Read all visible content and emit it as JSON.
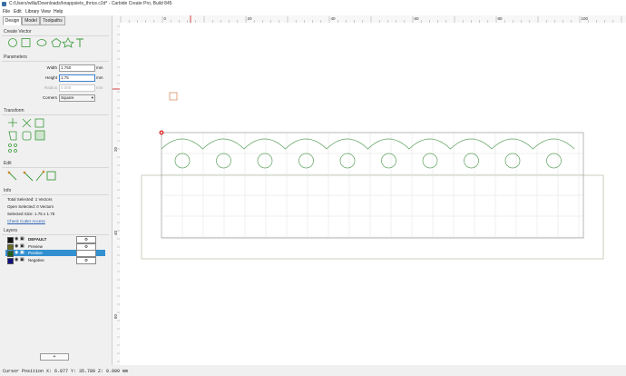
{
  "window": {
    "title": "C:/Users/willa/Downloads/knappsiets_thrice.c2d* - Carbide Create Pro, Build 845"
  },
  "menu": [
    "File",
    "Edit",
    "Library",
    "View",
    "Help"
  ],
  "tabs": [
    "Design",
    "Model",
    "Toolpaths"
  ],
  "sections": {
    "create_vector": "Create Vector",
    "parameters": "Parameters",
    "transform": "Transform",
    "edit": "Edit",
    "info": "Info",
    "layers": "Layers"
  },
  "parameters": {
    "width_label": "Width",
    "width_value": "1.750",
    "height_label": "Height",
    "height_value": "1.75",
    "radius_label": "Radius",
    "radius_value": "0.000",
    "corners_label": "Corners",
    "corners_value": "Square",
    "unit": "mm"
  },
  "info": {
    "total_selected": "Total Selected:  1 Vectors",
    "open_selected": "Open Selected:  0 Vectors",
    "selected_size": "Selected Size:   1.75 x 1.75",
    "check_cutter": "Check Cutter Access"
  },
  "layers": [
    {
      "name": "DEFAULT",
      "color": "#111111",
      "bold": true,
      "selected": false
    },
    {
      "name": "Preview",
      "color": "#6b6b1f",
      "bold": false,
      "selected": false
    },
    {
      "name": "Positive",
      "color": "#1f5f1f",
      "bold": false,
      "selected": true
    },
    {
      "name": "Negative",
      "color": "#101080",
      "bold": false,
      "selected": false
    }
  ],
  "add_layer_label": "+",
  "ruler": {
    "h_labels": [
      "0",
      "20",
      "40",
      "60",
      "80",
      "100"
    ],
    "v_labels": [
      "20",
      "40",
      "60"
    ]
  },
  "status": "Cursor Position X: 6.877 Y: 35.780 Z: 0.000 mm",
  "colors": {
    "selection": "#3390d0",
    "vector": "#5aa05a",
    "accent": "#d04040"
  }
}
